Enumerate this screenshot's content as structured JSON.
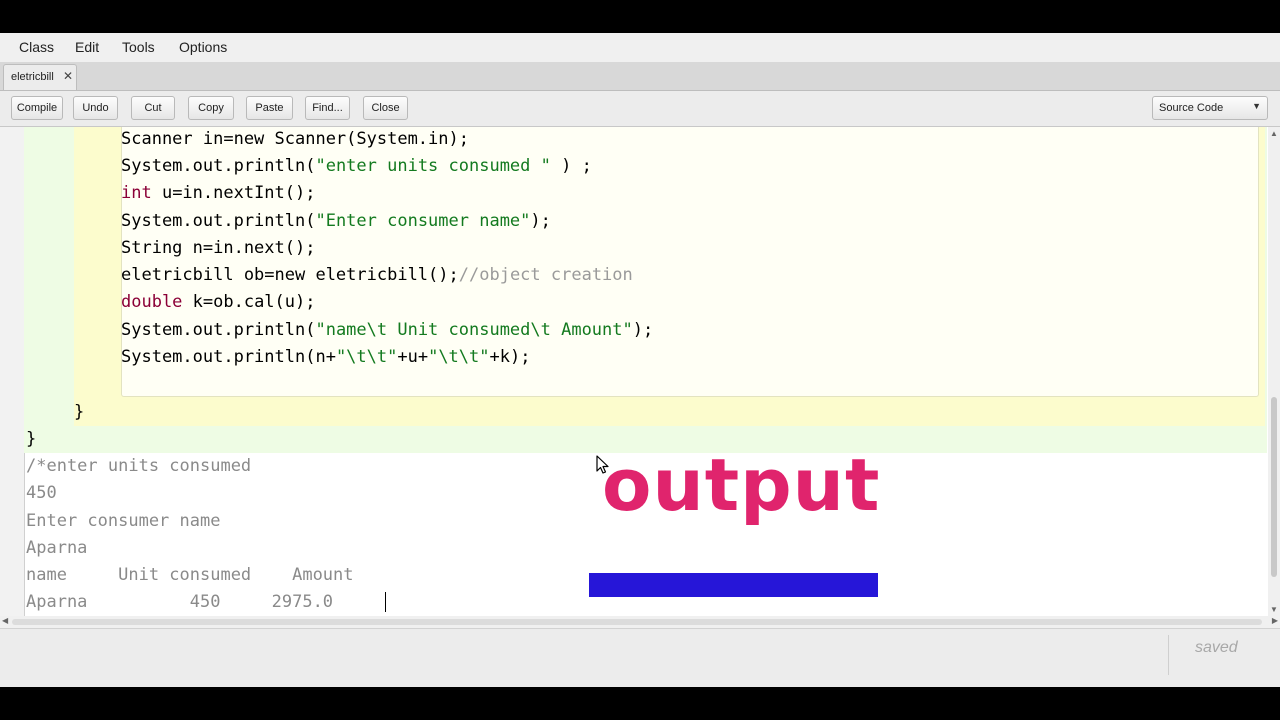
{
  "menu": [
    "Class",
    "Edit",
    "Tools",
    "Options"
  ],
  "tab": {
    "label": "eletricbill",
    "close": "✕"
  },
  "toolbar": {
    "buttons": [
      "Compile",
      "Undo",
      "Cut",
      "Copy",
      "Paste",
      "Find...",
      "Close"
    ],
    "view_selected": "Source Code"
  },
  "code": {
    "l1": "Scanner in=new Scanner(System.in);",
    "l2a": "System.out.println(",
    "l2s": "\"enter units consumed \"",
    "l2b": " ) ;",
    "l3k": "int",
    "l3": " u=in.nextInt();",
    "l4a": "System.out.println(",
    "l4s": "\"Enter consumer name\"",
    "l4b": ");",
    "l5": "String n=in.next();",
    "l6": "eletricbill ob=new eletricbill();",
    "l6c": "//object creation",
    "l7k": "double",
    "l7": " k=ob.cal(u);",
    "l8a": "System.out.println(",
    "l8s": "\"name\\t Unit consumed\\t Amount\"",
    "l8b": ");",
    "l9a": "System.out.println(n+",
    "l9s1": "\"\\t\\t\"",
    "l9m": "+u+",
    "l9s2": "\"\\t\\t\"",
    "l9b": "+k);",
    "method_close": "}",
    "class_close": "}"
  },
  "output_lines": [
    "/*enter units consumed",
    "450",
    "Enter consumer name",
    "Aparna",
    "name     Unit consumed    Amount",
    "Aparna          450     2975.0"
  ],
  "overlay": {
    "title": "output",
    "bar_color": "#2616d8",
    "title_color": "#e0246d"
  },
  "status": "saved",
  "colors": {
    "keyword": "#8b0037",
    "string": "#137a1f",
    "comment": "#9a9a9a",
    "class_scope": "#eefce4",
    "method_scope": "#fcfccd"
  }
}
